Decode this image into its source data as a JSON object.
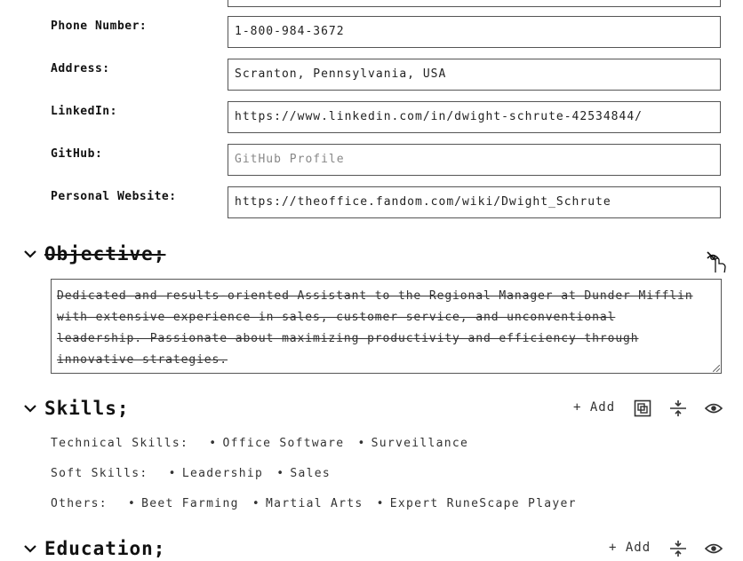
{
  "contact": {
    "phone_label": "Phone Number:",
    "phone_value": "1-800-984-3672",
    "address_label": "Address:",
    "address_value": "Scranton, Pennsylvania, USA",
    "linkedin_label": "LinkedIn:",
    "linkedin_value": "https://www.linkedin.com/in/dwight-schrute-42534844/",
    "github_label": "GitHub:",
    "github_placeholder": "GitHub Profile",
    "website_label": "Personal Website:",
    "website_value": "https://theoffice.fandom.com/wiki/Dwight_Schrute"
  },
  "objective": {
    "title": "Objective;",
    "text": "Dedicated and results-oriented Assistant to the Regional Manager at Dunder Mifflin with extensive experience in sales, customer service, and unconventional leadership. Passionate about maximizing productivity and efficiency through innovative strategies."
  },
  "skills": {
    "title": "Skills;",
    "add_label": "+ Add",
    "rows": [
      {
        "label": "Technical Skills:",
        "items": [
          "Office Software",
          "Surveillance"
        ]
      },
      {
        "label": "Soft Skills:",
        "items": [
          "Leadership",
          "Sales"
        ]
      },
      {
        "label": "Others:",
        "items": [
          "Beet Farming",
          "Martial Arts",
          "Expert RuneScape Player"
        ]
      }
    ]
  },
  "education": {
    "title": "Education;",
    "add_label": "+ Add"
  },
  "icons": {
    "chevron": "chevron-down-icon",
    "hide": "eye-slash-icon",
    "visible": "eye-icon",
    "layout": "layout-toggle-icon",
    "spacing": "spacing-adjust-icon"
  }
}
